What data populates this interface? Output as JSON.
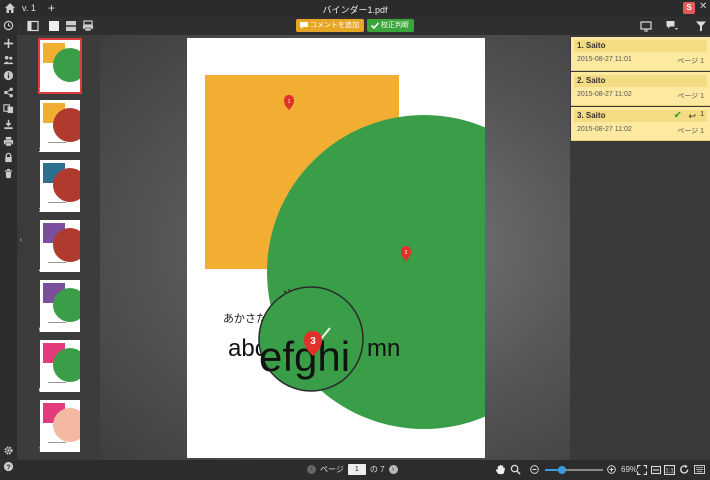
{
  "titlebar": {
    "version": "v. 1",
    "new_tab": "+",
    "filename": "バインダー1.pdf",
    "user_initial": "S",
    "close": "✕"
  },
  "toolbar": {
    "add_comment_label": "コメントを追加",
    "review_label": "校正判断"
  },
  "thumbnails": {
    "pages": [
      "1",
      "2",
      "3",
      "4",
      "5",
      "6",
      "7"
    ],
    "selected_page": 1,
    "collapse_glyph": "‹"
  },
  "document": {
    "line1": "あかさた",
    "line2": "やらわ",
    "line3_left": "abc",
    "line3_magnified": "efghi",
    "line3_right": "mn",
    "markers": [
      "1",
      "2",
      "3"
    ],
    "colors": {
      "orange": "#f2ad33",
      "green": "#3a9e49",
      "marker_red": "#e0322b"
    }
  },
  "comments": [
    {
      "title": "1. Saito",
      "date": "2015-08-27 11:01",
      "page": "ページ 1"
    },
    {
      "title": "2. Saito",
      "date": "2015-08-27 11:02",
      "page": "ページ 1"
    },
    {
      "title": "3. Saito",
      "date": "2015-08-27 11:02",
      "page": "ページ 1",
      "reply_count": "1"
    }
  ],
  "statusbar": {
    "page_label": "ページ",
    "current_page": "1",
    "total_label": "の 7",
    "zoom": "69%"
  }
}
